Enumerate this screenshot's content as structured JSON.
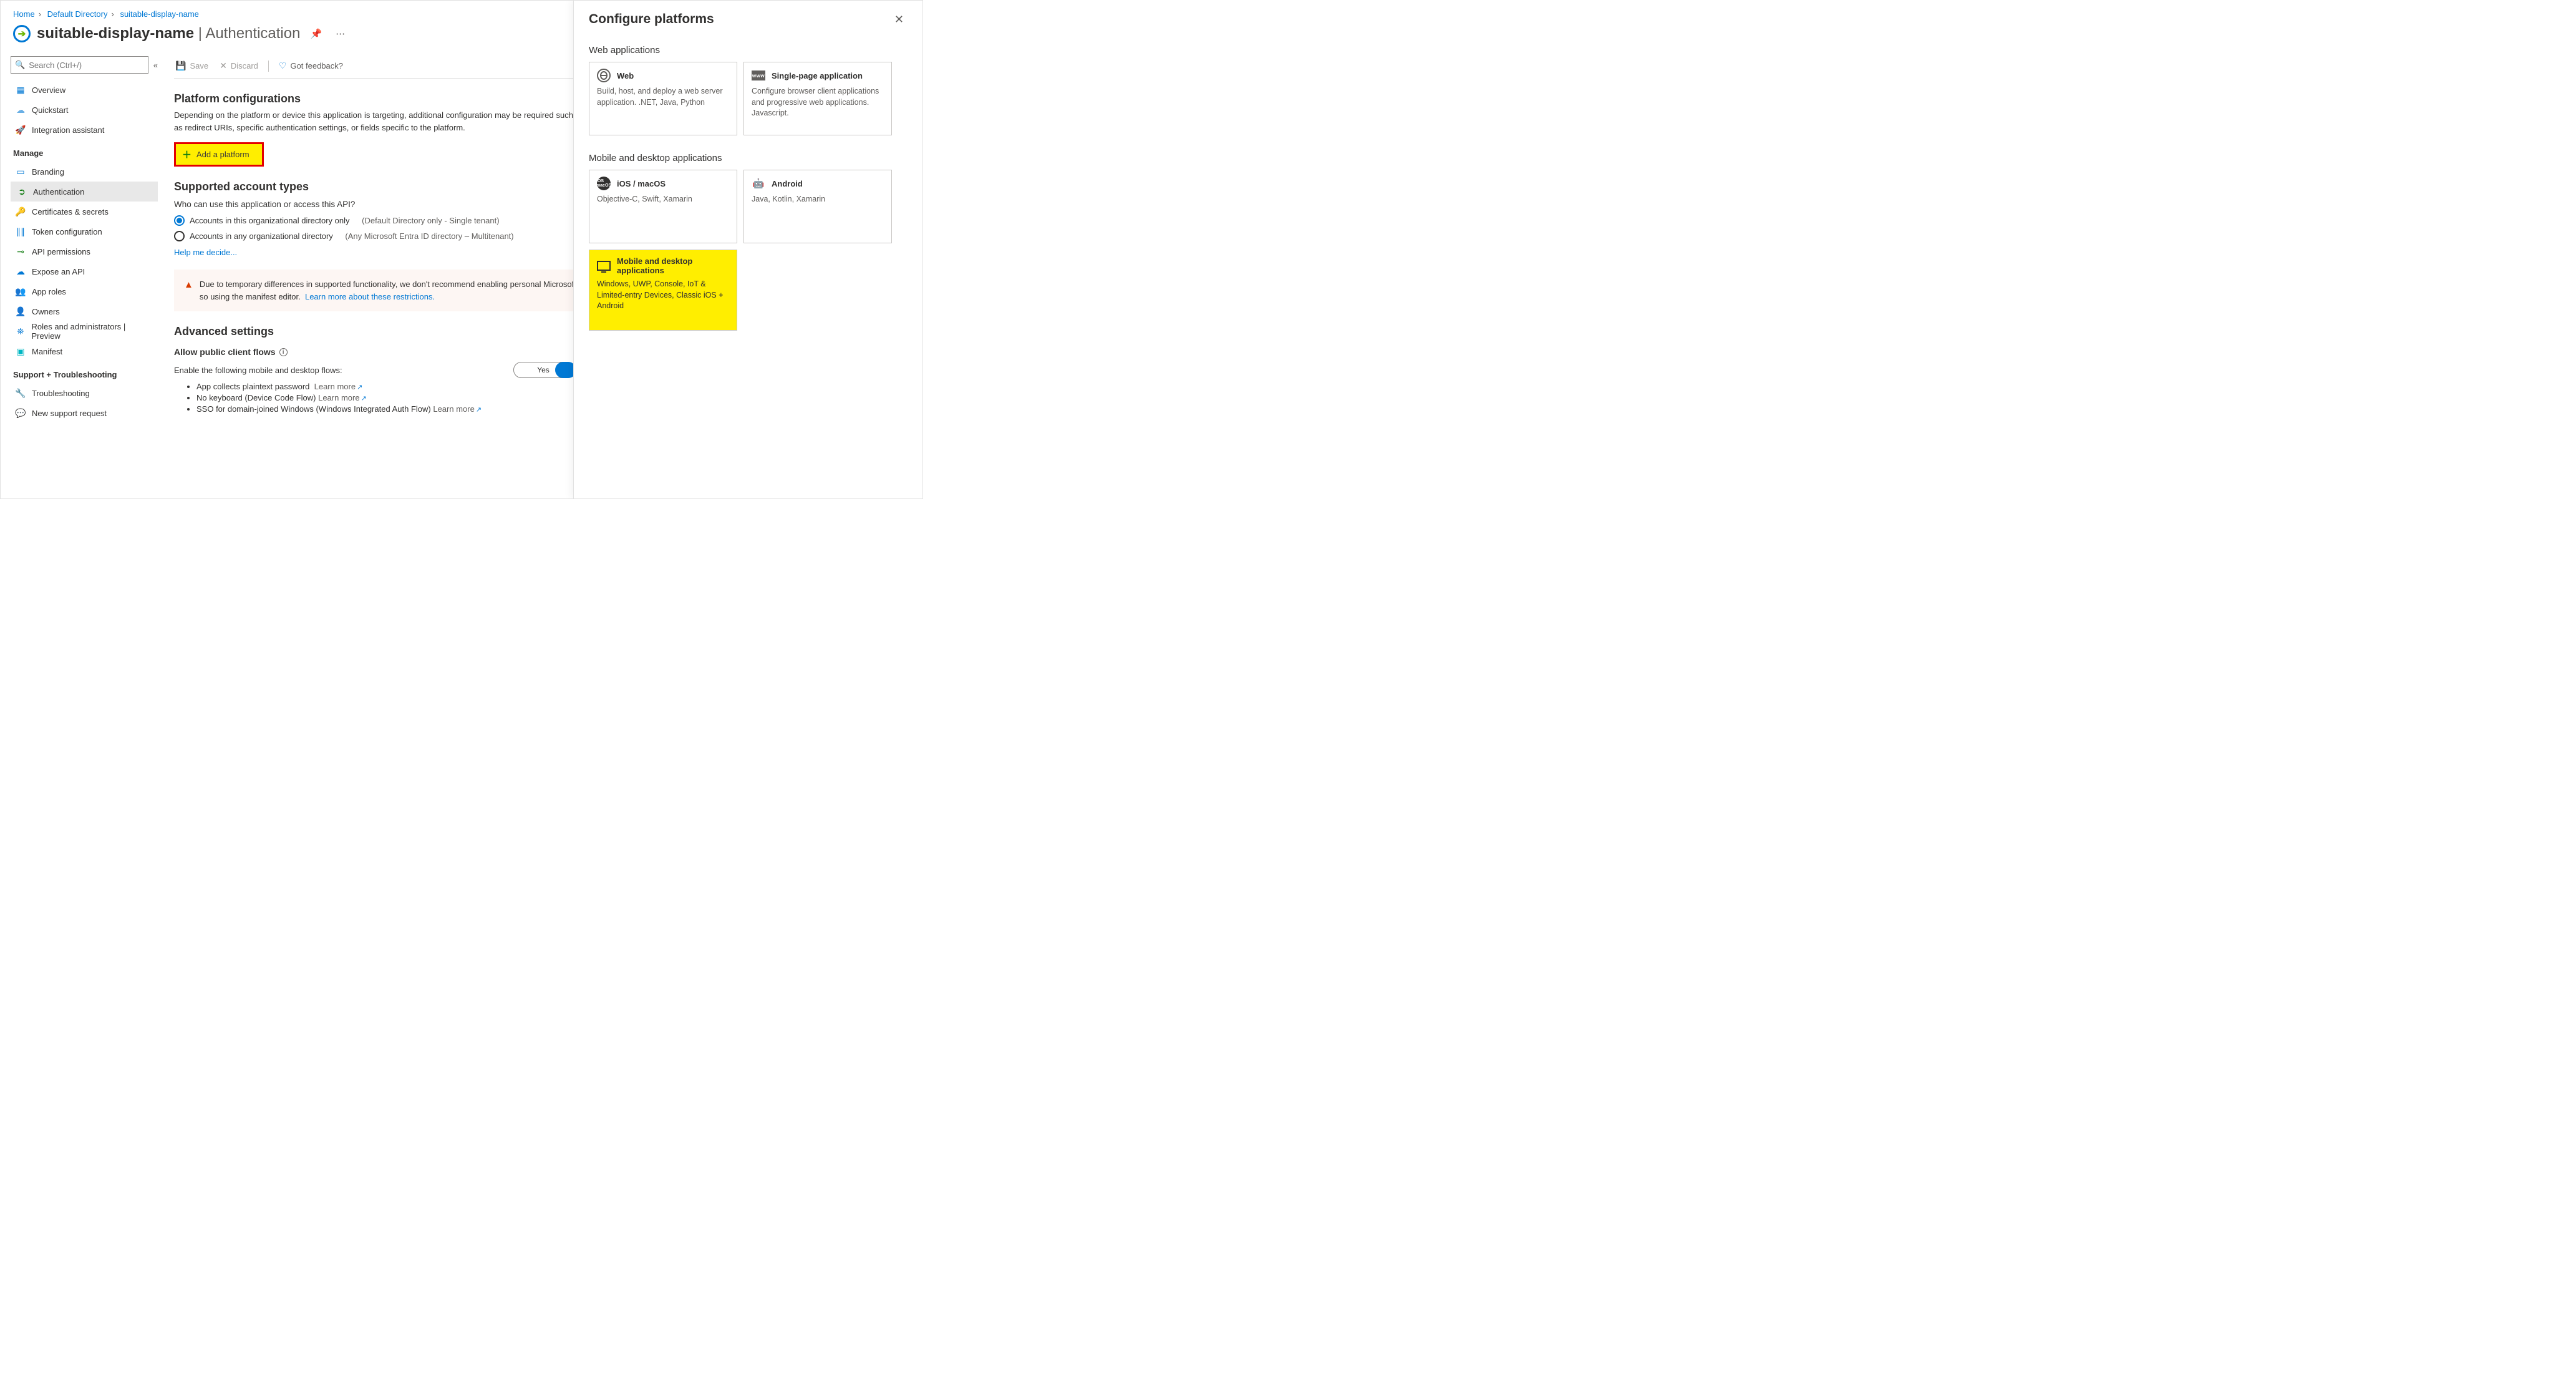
{
  "breadcrumbs": {
    "home": "Home",
    "dir": "Default Directory",
    "app": "suitable-display-name"
  },
  "header": {
    "appName": "suitable-display-name",
    "section": "Authentication"
  },
  "search": {
    "placeholder": "Search (Ctrl+/)"
  },
  "nav": {
    "top": [
      {
        "label": "Overview",
        "icon": "▦",
        "cls": "c-blue"
      },
      {
        "label": "Quickstart",
        "icon": "☁",
        "cls": "c-cloud"
      },
      {
        "label": "Integration assistant",
        "icon": "🚀",
        "cls": "c-orange"
      }
    ],
    "manageLabel": "Manage",
    "manage": [
      {
        "label": "Branding",
        "icon": "▭",
        "cls": "c-blue"
      },
      {
        "label": "Authentication",
        "icon": "➲",
        "cls": "c-green",
        "active": true,
        "highlight": true
      },
      {
        "label": "Certificates & secrets",
        "icon": "🔑",
        "cls": "c-yellow"
      },
      {
        "label": "Token configuration",
        "icon": "∥∥",
        "cls": "c-blue"
      },
      {
        "label": "API permissions",
        "icon": "⊸",
        "cls": "c-green"
      },
      {
        "label": "Expose an API",
        "icon": "☁",
        "cls": "c-blue"
      },
      {
        "label": "App roles",
        "icon": "👥",
        "cls": "c-grid"
      },
      {
        "label": "Owners",
        "icon": "👤",
        "cls": "c-blue"
      },
      {
        "label": "Roles and administrators | Preview",
        "icon": "⛯",
        "cls": "c-blue"
      },
      {
        "label": "Manifest",
        "icon": "▣",
        "cls": "c-teal"
      }
    ],
    "supportLabel": "Support + Troubleshooting",
    "support": [
      {
        "label": "Troubleshooting",
        "icon": "🔧",
        "cls": "c-dark"
      },
      {
        "label": "New support request",
        "icon": "💬",
        "cls": "c-blue"
      }
    ]
  },
  "cmd": {
    "save": "Save",
    "discard": "Discard",
    "feedback": "Got feedback?"
  },
  "platform": {
    "h": "Platform configurations",
    "p": "Depending on the platform or device this application is targeting, additional configuration may be required such as redirect URIs, specific authentication settings, or fields specific to the platform.",
    "add": "Add a platform"
  },
  "accounts": {
    "h": "Supported account types",
    "q": "Who can use this application or access this API?",
    "opt1": "Accounts in this organizational directory only",
    "opt1p": "(Default Directory only - Single tenant)",
    "opt2": "Accounts in any organizational directory",
    "opt2p": "(Any Microsoft Entra ID directory – Multitenant)",
    "help": "Help me decide..."
  },
  "alert": {
    "text": "Due to temporary differences in supported functionality, we don't recommend enabling personal Microsoft accounts for an existing registration. If you need to enable personal accounts, you can do so using the manifest editor.",
    "link": "Learn more about these restrictions."
  },
  "advanced": {
    "h": "Advanced settings",
    "sub": "Allow public client flows",
    "enable": "Enable the following mobile and desktop flows:",
    "yes": "Yes",
    "b1": "App collects plaintext password",
    "b1l": "Learn more",
    "b2": "No keyboard (Device Code Flow)",
    "b2l": "Learn more",
    "b3": "SSO for domain-joined Windows (Windows Integrated Auth Flow)",
    "b3l": "Learn more"
  },
  "panel": {
    "title": "Configure platforms",
    "g1": "Web applications",
    "web": {
      "t": "Web",
      "d": "Build, host, and deploy a web server application. .NET, Java, Python"
    },
    "spa": {
      "t": "Single-page application",
      "d": "Configure browser client applications and progressive web applications. Javascript."
    },
    "g2": "Mobile and desktop applications",
    "ios": {
      "t": "iOS / macOS",
      "d": "Objective-C, Swift, Xamarin"
    },
    "android": {
      "t": "Android",
      "d": "Java, Kotlin, Xamarin"
    },
    "desktop": {
      "t": "Mobile and desktop applications",
      "d": "Windows, UWP, Console, IoT & Limited-entry Devices, Classic iOS + Android"
    }
  }
}
